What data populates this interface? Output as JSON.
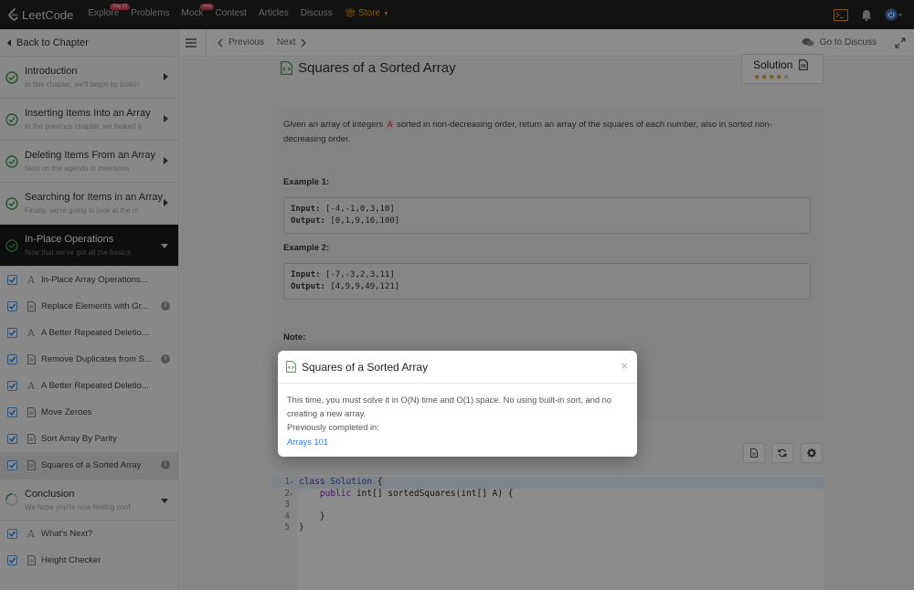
{
  "nav": {
    "logo": "LeetCode",
    "links": [
      {
        "label": "Explore",
        "badge": "Day 20"
      },
      {
        "label": "Problems",
        "badge": ""
      },
      {
        "label": "Mock",
        "badge": "new"
      },
      {
        "label": "Contest",
        "badge": ""
      },
      {
        "label": "Articles",
        "badge": ""
      },
      {
        "label": "Discuss",
        "badge": ""
      }
    ],
    "store": "Store"
  },
  "sidebar": {
    "back": "Back to Chapter",
    "chapters": [
      {
        "title": "Introduction",
        "sub": "In this chapter, we'll begin by lookin"
      },
      {
        "title": "Inserting Items Into an Array",
        "sub": "In the previous chapter, we looked a"
      },
      {
        "title": "Deleting Items From an Array",
        "sub": "Next on the agenda is insertions"
      },
      {
        "title": "Searching for Items in an Array",
        "sub": "Finally, we're going to look at the m"
      },
      {
        "title": "In-Place Operations",
        "sub": "Now that we've got all the basics"
      }
    ],
    "items": [
      {
        "label": "In-Place Array Operations..."
      },
      {
        "label": "Replace Elements with Gr..."
      },
      {
        "label": "A Better Repeated Deletio..."
      },
      {
        "label": "Remove Duplicates from S..."
      },
      {
        "label": "A Better Repeated Deletio..."
      },
      {
        "label": "Move Zeroes"
      },
      {
        "label": "Sort Array By Parity"
      },
      {
        "label": "Squares of a Sorted Array"
      }
    ],
    "conclusion": {
      "title": "Conclusion",
      "sub": "We hope you're now feeling conf"
    },
    "items2": [
      {
        "label": "What's Next?"
      },
      {
        "label": "Height Checker"
      }
    ]
  },
  "toolbar": {
    "previous": "Previous",
    "next": "Next",
    "discuss": "Go to Discuss"
  },
  "question": {
    "title": "Squares of a Sorted Array",
    "solution": "Solution",
    "rating": 4,
    "desc_pre": "Given an array of integers",
    "desc_code": "A",
    "desc_post": "sorted in non-decreasing order, return an array of the squares of each number, also in sorted non-decreasing order.",
    "ex1": {
      "title": "Example 1:",
      "input_label": "Input:",
      "input": "[-4,-1,0,3,10]",
      "output_label": "Output:",
      "output": "[0,1,9,16,100]"
    },
    "ex2": {
      "title": "Example 2:",
      "input_label": "Input:",
      "input": "[-7,-3,2,3,11]",
      "output_label": "Output:",
      "output": "[4,9,9,49,121]"
    },
    "note": "Note:"
  },
  "editor": {
    "lines": [
      {
        "n": "1",
        "fold": "▾",
        "code": "class Solution {"
      },
      {
        "n": "2",
        "fold": "▾",
        "code": "    public int[] sortedSquares(int[] A) {"
      },
      {
        "n": "3",
        "fold": "",
        "code": ""
      },
      {
        "n": "4",
        "fold": "",
        "code": "    }"
      },
      {
        "n": "5",
        "fold": "",
        "code": "}"
      }
    ]
  },
  "modal": {
    "title": "Squares of a Sorted Array",
    "close": "×",
    "body": "This time, you must solve it in O(N) time and O(1) space. No using built-in sort, and no creating a new array.",
    "prev_label": "Previously completed in:",
    "link": "Arrays 101"
  },
  "colors": {
    "accent": "#f0a020",
    "check": "#3c9d4e",
    "link": "#2c7be0",
    "badge": "#d9455f"
  }
}
